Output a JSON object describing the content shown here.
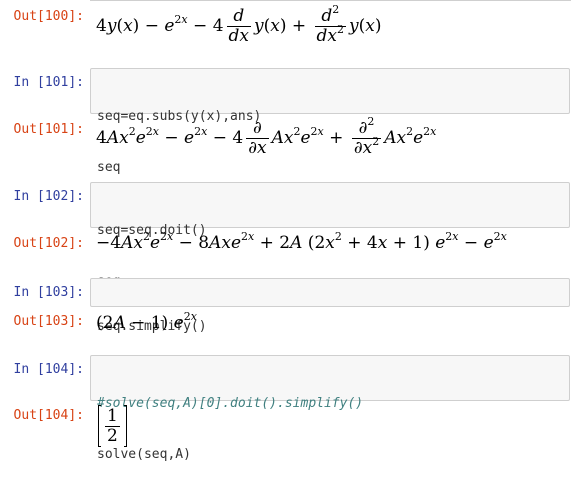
{
  "cells": [
    {
      "out_prompt": "Out[100]:"
    },
    {
      "in_prompt": "In [101]:",
      "code": [
        "seq=eq.subs(y(x),ans)",
        "seq"
      ],
      "out_prompt": "Out[101]:"
    },
    {
      "in_prompt": "In [102]:",
      "code": [
        "seq=seq.doit()",
        "seq"
      ],
      "out_prompt": "Out[102]:"
    },
    {
      "in_prompt": "In [103]:",
      "code": [
        "seq.simplify()"
      ],
      "out_prompt": "Out[103]:"
    },
    {
      "in_prompt": "In [104]:",
      "comment": "#solve(seq,A)[0].doit().simplify()",
      "code": [
        "solve(seq,A)"
      ],
      "out_prompt": "Out[104]:"
    }
  ],
  "outputs": {
    "out100": "4y(x) − e^{2x} − 4 d/dx y(x) + d²/dx² y(x)",
    "out101": "4Ax²e^{2x} − e^{2x} − 4 ∂/∂x Ax²e^{2x} + ∂²/∂x² Ax²e^{2x}",
    "out102": "−4Ax²e^{2x} − 8Axe^{2x} + 2A(2x² + 4x + 1)e^{2x} − e^{2x}",
    "out103": "(2A − 1)e^{2x}",
    "out104": "[1/2]"
  },
  "colors": {
    "in_prompt": "#303f9f",
    "out_prompt": "#d84315",
    "cell_bg": "#f7f7f7",
    "cell_border": "#cfcfcf",
    "comment": "#408080"
  }
}
